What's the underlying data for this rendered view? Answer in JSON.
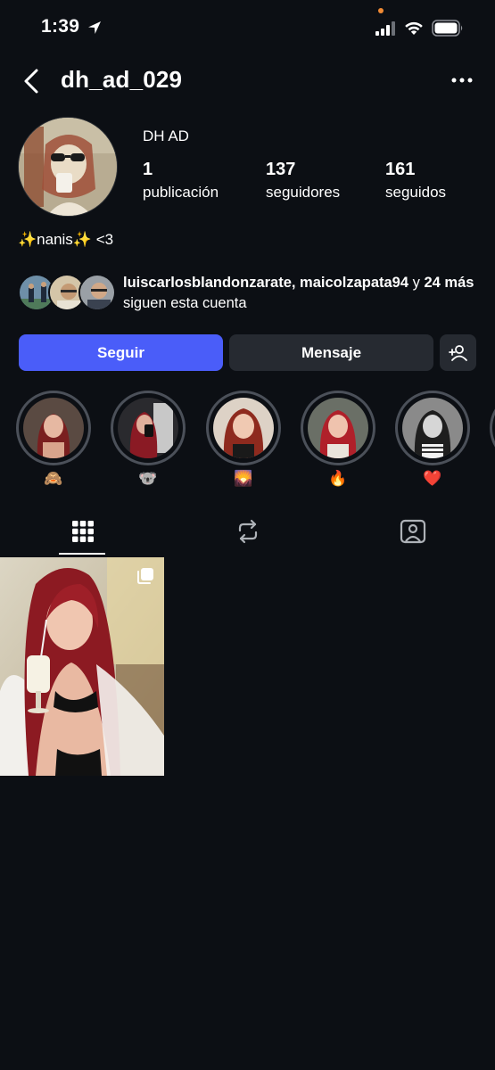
{
  "status_bar": {
    "time": "1:39"
  },
  "header": {
    "username": "dh_ad_029"
  },
  "profile": {
    "display_name": "DH AD",
    "stats": {
      "posts_count": "1",
      "posts_label": "publicación",
      "followers_count": "137",
      "followers_label": "seguidores",
      "following_count": "161",
      "following_label": "seguidos"
    },
    "bio": "✨nanis✨ <3"
  },
  "followed_by": {
    "names": "luiscarlosblandonzarate, maicolzapata94",
    "connector": " y ",
    "more": "24 más",
    "suffix": " siguen esta cuenta"
  },
  "actions": {
    "follow_label": "Seguir",
    "message_label": "Mensaje"
  },
  "highlights": [
    {
      "label": "🙈"
    },
    {
      "label": "🐨"
    },
    {
      "label": "🌄"
    },
    {
      "label": "🔥"
    },
    {
      "label": "❤️"
    }
  ],
  "colors": {
    "background": "#0c0f14",
    "follow_button": "#4a5df9",
    "secondary_button": "#262a31",
    "ring": "#4b5059"
  },
  "icons": [
    "location-arrow-icon",
    "signal-icon",
    "wifi-icon",
    "battery-icon",
    "back-chevron-icon",
    "more-dots-icon",
    "add-person-icon",
    "grid-icon",
    "reels-repost-icon",
    "tagged-person-icon",
    "multiple-images-icon"
  ]
}
